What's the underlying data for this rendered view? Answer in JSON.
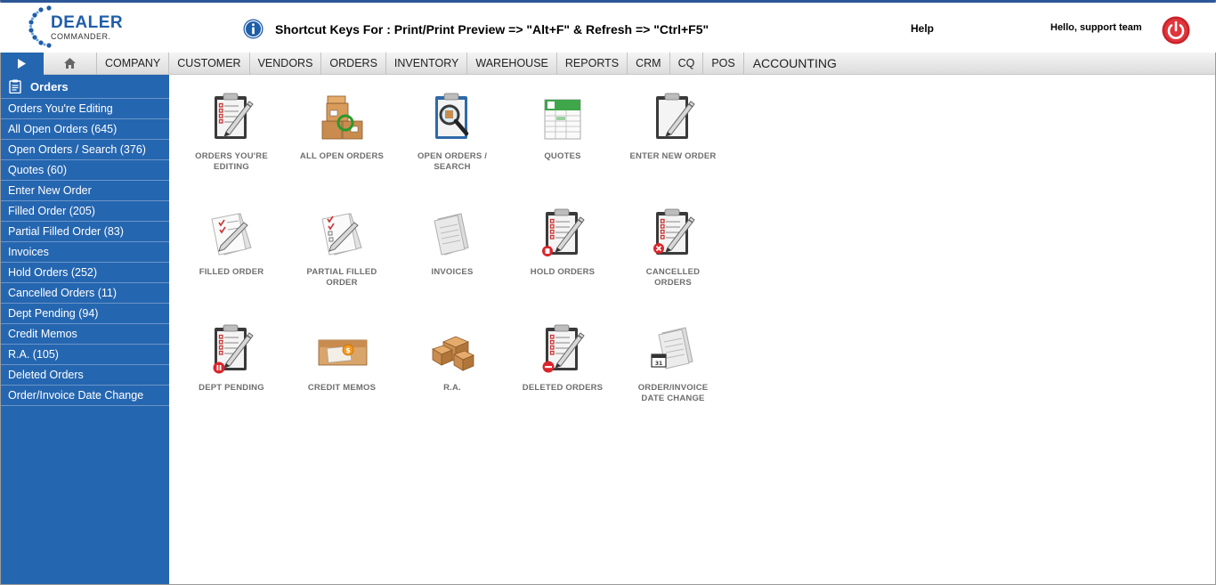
{
  "header": {
    "logo_line1": "DEALER",
    "logo_line2": "COMMANDER.",
    "shortcut_text": "Shortcut Keys For : Print/Print Preview => \"Alt+F\" & Refresh => \"Ctrl+F5\"",
    "help": "Help",
    "greeting": "Hello, support team"
  },
  "nav": {
    "items": [
      "COMPANY",
      "CUSTOMER",
      "VENDORS",
      "ORDERS",
      "INVENTORY",
      "WAREHOUSE",
      "REPORTS",
      "CRM",
      "CQ",
      "POS",
      "ACCOUNTING"
    ]
  },
  "sidebar": {
    "title": "Orders",
    "items": [
      "Orders You're Editing",
      "All Open Orders (645)",
      "Open Orders / Search (376)",
      "Quotes (60)",
      "Enter New Order",
      "Filled Order (205)",
      "Partial Filled Order (83)",
      "Invoices",
      "Hold Orders (252)",
      "Cancelled Orders (11)",
      "Dept Pending (94)",
      "Credit Memos",
      "R.A. (105)",
      "Deleted Orders",
      "Order/Invoice Date Change"
    ]
  },
  "tiles": [
    {
      "label1": "ORDERS YOU'RE",
      "label2": "EDITING",
      "icon": "clipboard-pen-icon"
    },
    {
      "label1": "ALL OPEN ORDERS",
      "label2": "",
      "icon": "boxes-icon"
    },
    {
      "label1": "OPEN ORDERS /",
      "label2": "SEARCH",
      "icon": "clipboard-magnifier-icon"
    },
    {
      "label1": "QUOTES",
      "label2": "",
      "icon": "quotes-sheet-icon"
    },
    {
      "label1": "ENTER NEW ORDER",
      "label2": "",
      "icon": "blank-clipboard-icon"
    },
    {
      "label1": "FILLED ORDER",
      "label2": "",
      "icon": "checked-papers-icon"
    },
    {
      "label1": "PARTIAL FILLED",
      "label2": "ORDER",
      "icon": "partial-checked-papers-icon"
    },
    {
      "label1": "INVOICES",
      "label2": "",
      "icon": "invoice-paper-icon"
    },
    {
      "label1": "HOLD ORDERS",
      "label2": "",
      "icon": "clipboard-hold-icon"
    },
    {
      "label1": "CANCELLED",
      "label2": "ORDERS",
      "icon": "clipboard-cancel-icon"
    },
    {
      "label1": "DEPT PENDING",
      "label2": "",
      "icon": "clipboard-pause-icon"
    },
    {
      "label1": "CREDIT MEMOS",
      "label2": "",
      "icon": "money-envelope-icon"
    },
    {
      "label1": "R.A.",
      "label2": "",
      "icon": "return-boxes-icon"
    },
    {
      "label1": "DELETED ORDERS",
      "label2": "",
      "icon": "clipboard-delete-icon"
    },
    {
      "label1": "ORDER/INVOICE",
      "label2": "DATE CHANGE",
      "icon": "invoice-calendar-icon"
    }
  ]
}
